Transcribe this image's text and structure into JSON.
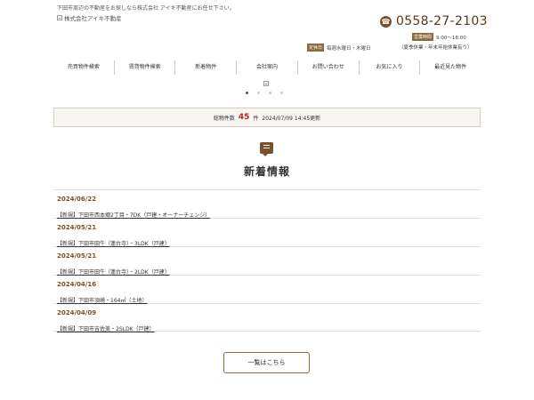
{
  "header": {
    "tagline": "下田市周辺の不動産をお探しなら株式会社 アイキ不動産にお任せ下さい。",
    "logo_alt": "株式会社アイキ不動産",
    "phone": "0558-27-2103",
    "hours_badge": "営業時間",
    "hours": "9:00～18:00",
    "holiday_badge": "定休日",
    "holiday": "毎週水曜日・木曜日",
    "holiday_note": "（夏季休業・年末年始休業有り）"
  },
  "nav": {
    "items": [
      {
        "label": "売買物件検索"
      },
      {
        "label": "賃貸物件検索"
      },
      {
        "label": "新着物件"
      },
      {
        "label": "会社案内"
      },
      {
        "label": "お問い合わせ"
      },
      {
        "label": "お気に入り"
      },
      {
        "label": "最近見た物件"
      }
    ]
  },
  "slider": {
    "active_index": 0,
    "dot_count": 4
  },
  "stats": {
    "label": "総物件数",
    "count": "45",
    "unit": "件",
    "updated": "2024/07/09 14:45更新"
  },
  "news": {
    "title": "新着情報",
    "items": [
      {
        "date": "2024/06/22",
        "text": "【新規】下田市西本郷2丁目・7DK（戸建・オーナーチェンジ）"
      },
      {
        "date": "2024/05/21",
        "text": "【新規】下田市田牛（蓮台寺）・3LDK（戸建）"
      },
      {
        "date": "2024/05/21",
        "text": "【新規】下田市田牛（蓮台寺）・2LDK（戸建）"
      },
      {
        "date": "2024/04/16",
        "text": "【新規】下田市須崎・164㎡（土地）"
      },
      {
        "date": "2024/04/09",
        "text": "【新規】下田市吉佐美・2SLDK（戸建）"
      }
    ],
    "more_label": "一覧はこちら"
  },
  "colors": {
    "accent_brown": "#7a5228",
    "count_red": "#c02020",
    "stats_bg": "#f8f6f1"
  },
  "icons": {
    "phone": "phone-icon",
    "news": "speech-bubble-icon"
  }
}
